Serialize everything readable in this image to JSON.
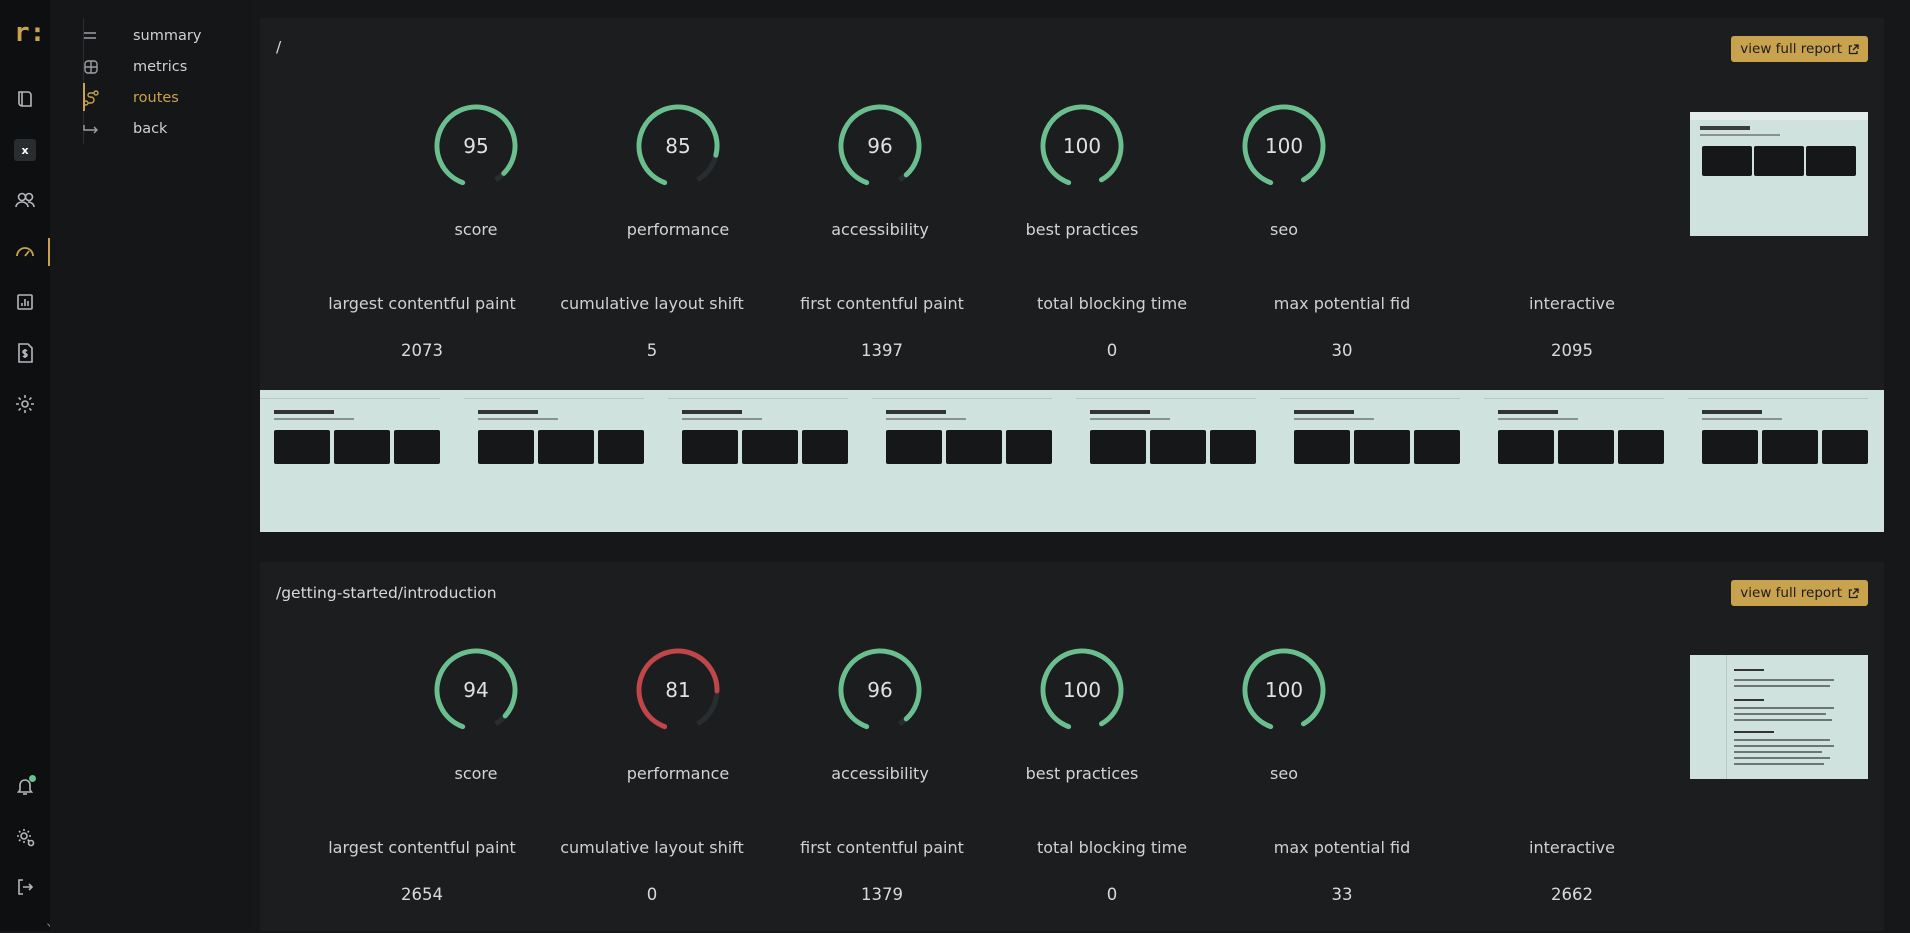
{
  "app": {
    "logo": "r:",
    "x_label": "x"
  },
  "rail": {
    "icons": [
      "book-icon",
      "x-badge-icon",
      "users-icon",
      "gauge-icon",
      "bar-chart-icon",
      "dollar-doc-icon",
      "gear-icon",
      "bell-icon",
      "settings-user-icon",
      "logout-icon"
    ],
    "active": "gauge-icon"
  },
  "subnav": {
    "items": [
      {
        "label": "summary",
        "icon": "list-icon"
      },
      {
        "label": "metrics",
        "icon": "metrics-icon"
      },
      {
        "label": "routes",
        "icon": "route-icon",
        "active": true
      },
      {
        "label": "back",
        "icon": "return-icon"
      }
    ]
  },
  "colors": {
    "accent": "#c9a24d",
    "good": "#6bbf8f",
    "poor": "#c0464a",
    "track": "#2a2d30"
  },
  "routes": [
    {
      "path": "/",
      "view_full_report": "view full report",
      "scores": [
        {
          "label": "score",
          "value": 95
        },
        {
          "label": "performance",
          "value": 85
        },
        {
          "label": "accessibility",
          "value": 96
        },
        {
          "label": "best practices",
          "value": 100
        },
        {
          "label": "seo",
          "value": 100
        }
      ],
      "metrics": [
        {
          "label": "largest contentful paint",
          "value": "2073"
        },
        {
          "label": "cumulative layout shift",
          "value": "5"
        },
        {
          "label": "first contentful paint",
          "value": "1397"
        },
        {
          "label": "total blocking time",
          "value": "0"
        },
        {
          "label": "max potential fid",
          "value": "30"
        },
        {
          "label": "interactive",
          "value": "2095"
        }
      ]
    },
    {
      "path": "/getting-started/introduction",
      "view_full_report": "view full report",
      "scores": [
        {
          "label": "score",
          "value": 94
        },
        {
          "label": "performance",
          "value": 81
        },
        {
          "label": "accessibility",
          "value": 96
        },
        {
          "label": "best practices",
          "value": 100
        },
        {
          "label": "seo",
          "value": 100
        }
      ],
      "metrics": [
        {
          "label": "largest contentful paint",
          "value": "2654"
        },
        {
          "label": "cumulative layout shift",
          "value": "0"
        },
        {
          "label": "first contentful paint",
          "value": "1379"
        },
        {
          "label": "total blocking time",
          "value": "0"
        },
        {
          "label": "max potential fid",
          "value": "33"
        },
        {
          "label": "interactive",
          "value": "2662"
        }
      ]
    }
  ]
}
